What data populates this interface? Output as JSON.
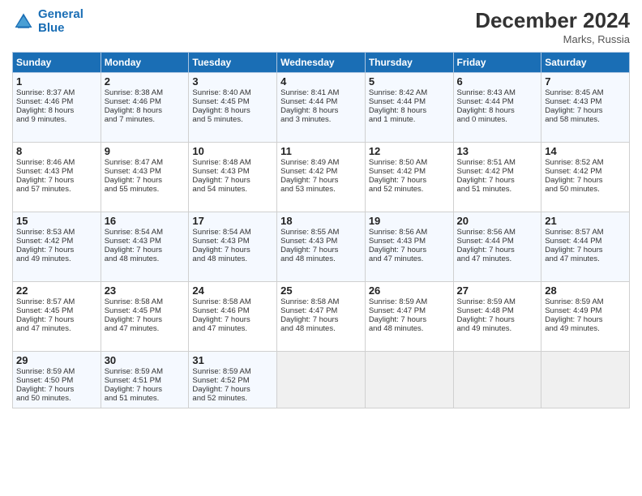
{
  "logo": {
    "line1": "General",
    "line2": "Blue"
  },
  "title": "December 2024",
  "location": "Marks, Russia",
  "days_header": [
    "Sunday",
    "Monday",
    "Tuesday",
    "Wednesday",
    "Thursday",
    "Friday",
    "Saturday"
  ],
  "weeks": [
    [
      {
        "day": "1",
        "info": "Sunrise: 8:37 AM\nSunset: 4:46 PM\nDaylight: 8 hours\nand 9 minutes."
      },
      {
        "day": "2",
        "info": "Sunrise: 8:38 AM\nSunset: 4:46 PM\nDaylight: 8 hours\nand 7 minutes."
      },
      {
        "day": "3",
        "info": "Sunrise: 8:40 AM\nSunset: 4:45 PM\nDaylight: 8 hours\nand 5 minutes."
      },
      {
        "day": "4",
        "info": "Sunrise: 8:41 AM\nSunset: 4:44 PM\nDaylight: 8 hours\nand 3 minutes."
      },
      {
        "day": "5",
        "info": "Sunrise: 8:42 AM\nSunset: 4:44 PM\nDaylight: 8 hours\nand 1 minute."
      },
      {
        "day": "6",
        "info": "Sunrise: 8:43 AM\nSunset: 4:44 PM\nDaylight: 8 hours\nand 0 minutes."
      },
      {
        "day": "7",
        "info": "Sunrise: 8:45 AM\nSunset: 4:43 PM\nDaylight: 7 hours\nand 58 minutes."
      }
    ],
    [
      {
        "day": "8",
        "info": "Sunrise: 8:46 AM\nSunset: 4:43 PM\nDaylight: 7 hours\nand 57 minutes."
      },
      {
        "day": "9",
        "info": "Sunrise: 8:47 AM\nSunset: 4:43 PM\nDaylight: 7 hours\nand 55 minutes."
      },
      {
        "day": "10",
        "info": "Sunrise: 8:48 AM\nSunset: 4:43 PM\nDaylight: 7 hours\nand 54 minutes."
      },
      {
        "day": "11",
        "info": "Sunrise: 8:49 AM\nSunset: 4:42 PM\nDaylight: 7 hours\nand 53 minutes."
      },
      {
        "day": "12",
        "info": "Sunrise: 8:50 AM\nSunset: 4:42 PM\nDaylight: 7 hours\nand 52 minutes."
      },
      {
        "day": "13",
        "info": "Sunrise: 8:51 AM\nSunset: 4:42 PM\nDaylight: 7 hours\nand 51 minutes."
      },
      {
        "day": "14",
        "info": "Sunrise: 8:52 AM\nSunset: 4:42 PM\nDaylight: 7 hours\nand 50 minutes."
      }
    ],
    [
      {
        "day": "15",
        "info": "Sunrise: 8:53 AM\nSunset: 4:42 PM\nDaylight: 7 hours\nand 49 minutes."
      },
      {
        "day": "16",
        "info": "Sunrise: 8:54 AM\nSunset: 4:43 PM\nDaylight: 7 hours\nand 48 minutes."
      },
      {
        "day": "17",
        "info": "Sunrise: 8:54 AM\nSunset: 4:43 PM\nDaylight: 7 hours\nand 48 minutes."
      },
      {
        "day": "18",
        "info": "Sunrise: 8:55 AM\nSunset: 4:43 PM\nDaylight: 7 hours\nand 48 minutes."
      },
      {
        "day": "19",
        "info": "Sunrise: 8:56 AM\nSunset: 4:43 PM\nDaylight: 7 hours\nand 47 minutes."
      },
      {
        "day": "20",
        "info": "Sunrise: 8:56 AM\nSunset: 4:44 PM\nDaylight: 7 hours\nand 47 minutes."
      },
      {
        "day": "21",
        "info": "Sunrise: 8:57 AM\nSunset: 4:44 PM\nDaylight: 7 hours\nand 47 minutes."
      }
    ],
    [
      {
        "day": "22",
        "info": "Sunrise: 8:57 AM\nSunset: 4:45 PM\nDaylight: 7 hours\nand 47 minutes."
      },
      {
        "day": "23",
        "info": "Sunrise: 8:58 AM\nSunset: 4:45 PM\nDaylight: 7 hours\nand 47 minutes."
      },
      {
        "day": "24",
        "info": "Sunrise: 8:58 AM\nSunset: 4:46 PM\nDaylight: 7 hours\nand 47 minutes."
      },
      {
        "day": "25",
        "info": "Sunrise: 8:58 AM\nSunset: 4:47 PM\nDaylight: 7 hours\nand 48 minutes."
      },
      {
        "day": "26",
        "info": "Sunrise: 8:59 AM\nSunset: 4:47 PM\nDaylight: 7 hours\nand 48 minutes."
      },
      {
        "day": "27",
        "info": "Sunrise: 8:59 AM\nSunset: 4:48 PM\nDaylight: 7 hours\nand 49 minutes."
      },
      {
        "day": "28",
        "info": "Sunrise: 8:59 AM\nSunset: 4:49 PM\nDaylight: 7 hours\nand 49 minutes."
      }
    ],
    [
      {
        "day": "29",
        "info": "Sunrise: 8:59 AM\nSunset: 4:50 PM\nDaylight: 7 hours\nand 50 minutes."
      },
      {
        "day": "30",
        "info": "Sunrise: 8:59 AM\nSunset: 4:51 PM\nDaylight: 7 hours\nand 51 minutes."
      },
      {
        "day": "31",
        "info": "Sunrise: 8:59 AM\nSunset: 4:52 PM\nDaylight: 7 hours\nand 52 minutes."
      },
      null,
      null,
      null,
      null
    ]
  ]
}
